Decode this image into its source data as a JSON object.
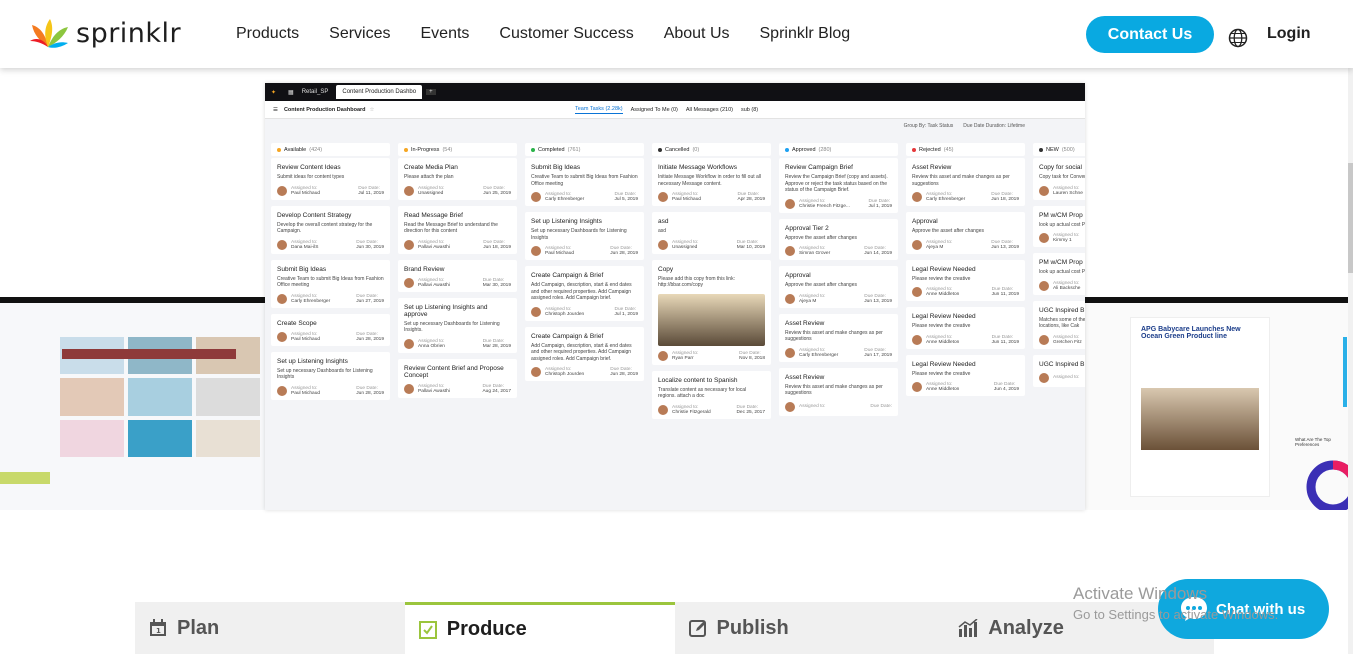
{
  "brand": {
    "name": "sprinklr"
  },
  "nav": {
    "items": [
      "Products",
      "Services",
      "Events",
      "Customer Success",
      "About Us",
      "Sprinklr Blog"
    ],
    "contact": "Contact Us",
    "login": "Login"
  },
  "app": {
    "top": {
      "workspace": "Retail_SP",
      "tab": "Content Production Dashbo"
    },
    "title": "Content Production Dashboard",
    "tabs": [
      "Team Tasks (2.28k)",
      "Assigned To Me (0)",
      "All Messages (210)",
      "sub (8)"
    ],
    "filter": {
      "group": "Group By: Task Status",
      "due": "Due Date Duration: Lifetime"
    },
    "columns": [
      {
        "name": "Available",
        "count": "(424)",
        "color": "#f5a623",
        "cards": [
          {
            "title": "Review Content Ideas",
            "desc": "Submit ideas for content types",
            "assignee": "Paul Michaud",
            "due": "Jul 11, 2019"
          },
          {
            "title": "Develop Content Strategy",
            "desc": "Develop the overall content strategy for the Campaign.",
            "assignee": "Dana Mai-ilS",
            "due": "Jun 30, 2019"
          },
          {
            "title": "Submit Big Ideas",
            "desc": "Creative Team to submit Big Ideas from Fashion Office meeting",
            "assignee": "Carly Ehrenberger",
            "due": "Jun 27, 2019"
          },
          {
            "title": "Create Scope",
            "desc": "",
            "assignee": "Paul Michaud",
            "due": "Jun 28, 2019"
          },
          {
            "title": "Set up Listening Insights",
            "desc": "Set up necessary Dashboards for Listening Insights",
            "assignee": "Paul Michaud",
            "due": "Jun 28, 2019"
          }
        ]
      },
      {
        "name": "In-Progress",
        "count": "(54)",
        "color": "#f5a623",
        "cards": [
          {
            "title": "Create Media Plan",
            "desc": "Please attach the plan",
            "assignee": "Unassigned",
            "due": "Jun 25, 2019"
          },
          {
            "title": "Read Message Brief",
            "desc": "Read the Message Brief to understand the direction for this content",
            "assignee": "Pallavi Awasthi",
            "due": "Jun 18, 2019"
          },
          {
            "title": "Brand Review",
            "desc": "",
            "assignee": "Pallavi Awasthi",
            "due": "Mar 30, 2019"
          },
          {
            "title": "Set up Listening Insights and approve",
            "desc": "Set up necessary Dashboards for Listening Insights.",
            "assignee": "Anna Obrien",
            "due": "Mar 28, 2019"
          },
          {
            "title": "Review Content Brief and Propose Concept",
            "desc": "",
            "assignee": "Pallavi Awasthi",
            "due": "Aug 24, 2017"
          }
        ]
      },
      {
        "name": "Completed",
        "count": "(761)",
        "color": "#2ab34a",
        "cards": [
          {
            "title": "Submit Big Ideas",
            "desc": "Creative Team to submit Big Ideas from Fashion Office meeting",
            "assignee": "Carly Ehrenberger",
            "due": "Jul 5, 2019"
          },
          {
            "title": "Set up Listening Insights",
            "desc": "Set up necessary Dashboards for Listening Insights",
            "assignee": "Paul Michaud",
            "due": "Jun 28, 2019"
          },
          {
            "title": "Create Campaign & Brief",
            "desc": "Add Campaign, description, start & end dates and other required properties. Add Campaign assigned roles. Add Campaign brief.",
            "assignee": "Christoph Jourden",
            "due": "Jul 1, 2019"
          },
          {
            "title": "Create Campaign & Brief",
            "desc": "Add Campaign, description, start & end dates and other required properties. Add Campaign assigned roles. Add Campaign brief.",
            "assignee": "Christoph Jourden",
            "due": "Jun 28, 2019"
          }
        ]
      },
      {
        "name": "Cancelled",
        "count": "(0)",
        "color": "#333333",
        "cards": [
          {
            "title": "Initiate Message Workflows",
            "desc": "Initiate Message Workflow in order to fill out all necessary Message content.",
            "assignee": "Paul Michaud",
            "due": "Apr 28, 2019"
          },
          {
            "title": "asd",
            "desc": "asd",
            "assignee": "Unassigned",
            "due": "Mar 10, 2019"
          },
          {
            "title": "Copy",
            "desc": "Please add this copy from this link: http://bbar.com/copy",
            "assignee": "Ryan Parr",
            "due": "Nov 8, 2018",
            "image": true
          },
          {
            "title": "Localize content to Spanish",
            "desc": "Translate content as necessary for local regions. attach a doc",
            "assignee": "Christie Fitzgerald",
            "due": "Dec 25, 2017"
          }
        ]
      },
      {
        "name": "Approved",
        "count": "(280)",
        "color": "#1da1f2",
        "cards": [
          {
            "title": "Review Campaign Brief",
            "desc": "Review the Campaign Brief (copy and assets). Approve or reject the task status based on the status of the Campaign Brief.",
            "assignee": "Christie French Fitzge...",
            "due": "Jul 1, 2019"
          },
          {
            "title": "Approval Tier 2",
            "desc": "Approve the asset after changes",
            "assignee": "Simran Grover",
            "due": "Jun 14, 2019"
          },
          {
            "title": "Approval",
            "desc": "Approve the asset after changes",
            "assignee": "Ajeya M",
            "due": "Jun 13, 2019"
          },
          {
            "title": "Asset Review",
            "desc": "Review this asset and make changes as per suggestions",
            "assignee": "Carly Ehrenberger",
            "due": "Jun 17, 2019"
          },
          {
            "title": "Asset Review",
            "desc": "Review this asset and make changes as per suggestions",
            "assignee": "",
            "due": ""
          }
        ]
      },
      {
        "name": "Rejected",
        "count": "(45)",
        "color": "#e5373a",
        "cards": [
          {
            "title": "Asset Review",
            "desc": "Review this asset and make changes as per suggestions",
            "assignee": "Carly Ehrenberger",
            "due": "Jun 18, 2019"
          },
          {
            "title": "Approval",
            "desc": "Approve the asset after changes",
            "assignee": "Ajeya M",
            "due": "Jun 13, 2019"
          },
          {
            "title": "Legal Review Needed",
            "desc": "Please review the creative",
            "assignee": "Anne Middleton",
            "due": "Jun 11, 2019"
          },
          {
            "title": "Legal Review Needed",
            "desc": "Please review the creative",
            "assignee": "Anne Middleton",
            "due": "Jun 11, 2019"
          },
          {
            "title": "Legal Review Needed",
            "desc": "Please review the creative",
            "assignee": "Anne Middleton",
            "due": "Jun 4, 2019"
          }
        ]
      },
      {
        "name": "NEW",
        "count": "(500)",
        "color": "#333333",
        "cards": [
          {
            "title": "Copy for social",
            "desc": "Copy task for Conver campaign",
            "assignee": "Lauren Schne",
            "due": ""
          },
          {
            "title": "PM w/CM Prop",
            "desc": "look up actual cost PMing with CM",
            "assignee": "Kimmy 1",
            "due": ""
          },
          {
            "title": "PM w/CM Prop",
            "desc": "look up actual cost PMing with CM",
            "assignee": "Ali Backsche",
            "due": ""
          },
          {
            "title": "UGC Inspired B Awareness Con",
            "desc": "Matches some of the steps with manning locations, like Cak",
            "assignee": "Gretchen Fitz",
            "due": ""
          },
          {
            "title": "UGC Inspired B Awareness Con",
            "desc": "",
            "assignee": "",
            "due": ""
          }
        ]
      }
    ],
    "labels": {
      "assigned": "Assigned to:",
      "due": "Due Date:"
    }
  },
  "right_panel": {
    "headline": "APG Babycare Launches New Ocean Green Product line",
    "chart_title": "What Are The Top Preferences"
  },
  "bottom_tabs": [
    "Plan",
    "Produce",
    "Publish",
    "Analyze"
  ],
  "chat": {
    "label": "Chat with us"
  },
  "watermark": {
    "line1": "Activate Windows",
    "line2": "Go to Settings to activate Windows."
  },
  "colors": {
    "accent": "#09a9e1",
    "produce": "#9bc53d"
  }
}
